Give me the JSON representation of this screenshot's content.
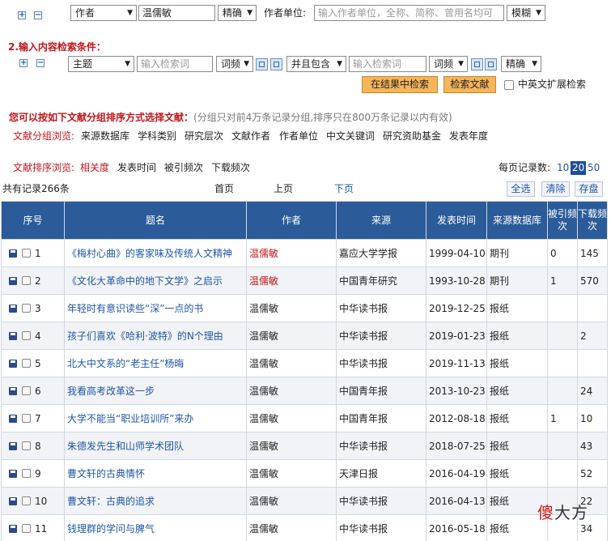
{
  "row1": {
    "field_select": "作者",
    "value": "温儒敏",
    "match_select": "精确",
    "unit_label": "作者单位:",
    "unit_placeholder": "输入作者单位，全称、简称、曾用名均可",
    "unit_match": "模糊"
  },
  "section2": {
    "label": "2.输入内容检索条件：",
    "field_select": "主题",
    "keyword1_placeholder": "输入检索词",
    "freq1": "词频",
    "logic_select": "并且包含",
    "keyword2_placeholder": "输入检索词",
    "freq2": "词频",
    "match_select": "精确",
    "search_in_results": "在结果中检索",
    "search_button": "检索文献",
    "cross_lang_label": "中英文扩展检索"
  },
  "grouping": {
    "heading": "您可以按如下文献分组排序方式选择文献：",
    "note": "(分组只对前4万条记录分组,排序只在800万条记录以内有效)",
    "browse_label": "文献分组浏览:",
    "browse_items": [
      "来源数据库",
      "学科类别",
      "研究层次",
      "文献作者",
      "作者单位",
      "中文关键词",
      "研究资助基金",
      "发表年度"
    ],
    "sort_label": "文献排序浏览:",
    "sort_items": [
      "相关度",
      "发表时间",
      "被引频次",
      "下载频次"
    ],
    "per_page_label": "每页记录数:",
    "per_page_options": [
      "10",
      "20",
      "50"
    ],
    "per_page_selected": "20"
  },
  "toolbar": {
    "total": "共有记录266条",
    "first": "首页",
    "prev": "上页",
    "next": "下页",
    "select_all": "全选",
    "clear": "清除",
    "save": "存盘"
  },
  "table": {
    "headers": [
      "序号",
      "题名",
      "作者",
      "来源",
      "发表时间",
      "来源数据库",
      "被引频次",
      "下载频次"
    ],
    "rows": [
      {
        "no": "1",
        "title": "《梅村心曲》的客家味及传统人文精神",
        "author": "温儒敏",
        "source": "嘉应大学学报",
        "date": "1999-04-10",
        "db": "期刊",
        "cited": "0",
        "downloads": "145"
      },
      {
        "no": "2",
        "title": "《文化大革命中的地下文学》之启示",
        "author": "温儒敏",
        "source": "中国青年研究",
        "date": "1993-10-28",
        "db": "期刊",
        "cited": "1",
        "downloads": "570"
      },
      {
        "no": "3",
        "title": "年轻时有意识读些“深”一点的书",
        "author": "温儒敏",
        "source": "中华读书报",
        "date": "2019-12-25",
        "db": "报纸",
        "cited": "",
        "downloads": ""
      },
      {
        "no": "4",
        "title": "孩子们喜欢《哈利·波特》的N个理由",
        "author": "温儒敏",
        "source": "中华读书报",
        "date": "2019-01-23",
        "db": "报纸",
        "cited": "",
        "downloads": "2"
      },
      {
        "no": "5",
        "title": "北大中文系的“老主任”杨晦",
        "author": "温儒敏",
        "source": "中华读书报",
        "date": "2019-11-13",
        "db": "报纸",
        "cited": "",
        "downloads": ""
      },
      {
        "no": "6",
        "title": "我看高考改革这一步",
        "author": "温儒敏",
        "source": "中国青年报",
        "date": "2013-10-23",
        "db": "报纸",
        "cited": "",
        "downloads": "24"
      },
      {
        "no": "7",
        "title": "大学不能当“职业培训所”来办",
        "author": "温儒敏",
        "source": "中国青年报",
        "date": "2012-08-18",
        "db": "报纸",
        "cited": "1",
        "downloads": "10"
      },
      {
        "no": "8",
        "title": "朱德发先生和山师学术团队",
        "author": "温儒敏",
        "source": "中华读书报",
        "date": "2018-07-25",
        "db": "报纸",
        "cited": "",
        "downloads": "43"
      },
      {
        "no": "9",
        "title": "曹文轩的古典情怀",
        "author": "温儒敏",
        "source": "天津日报",
        "date": "2016-04-19",
        "db": "报纸",
        "cited": "",
        "downloads": "52"
      },
      {
        "no": "10",
        "title": "曹文轩：古典的追求",
        "author": "温儒敏",
        "source": "中华读书报",
        "date": "2016-04-13",
        "db": "报纸",
        "cited": "",
        "downloads": "22"
      },
      {
        "no": "11",
        "title": "钱理群的学问与脾气",
        "author": "温儒敏",
        "source": "中华读书报",
        "date": "2016-05-18",
        "db": "报纸",
        "cited": "",
        "downloads": "34"
      }
    ]
  },
  "watermark": {
    "part1": "傻",
    "part2": "大方"
  }
}
